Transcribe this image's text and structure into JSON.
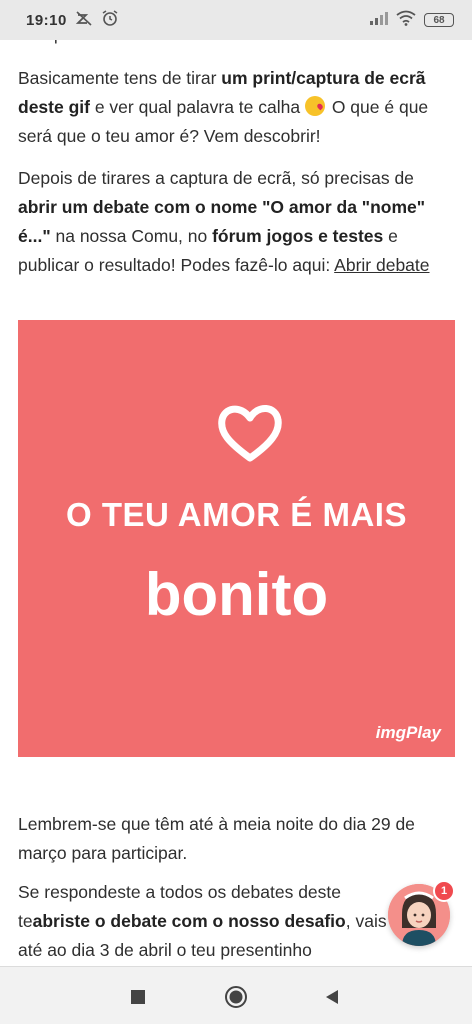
{
  "status_bar": {
    "time": "19:10",
    "battery": "68"
  },
  "article": {
    "partial_heading": "Em que consiste?",
    "p1": {
      "t1": "Basicamente tens de tirar ",
      "b1": "um print/captura de ecrã deste gif",
      "t2": " e ver qual palavra te calha ",
      "t3": " O que é que será que o teu amor é? Vem descobrir!"
    },
    "p2": {
      "t1": "Depois de tirares a captura de ecrã, só precisas de ",
      "b1": "abrir um debate com o nome \"O amor da \"nome\" é...\"",
      "t2": " na nossa Comu, no ",
      "b2": "fórum jogos e testes",
      "t3": " e publicar o resultado! Podes fazê-lo aqui: ",
      "link": "Abrir debate"
    },
    "p3": "Lembrem-se que têm até à meia noite do dia 29 de março para participar.",
    "p4": {
      "t1": "Se respondeste a todos os debates deste te",
      "b1": "abriste o debate com o nosso desafio",
      "t2": ", vais ",
      "t3": "até ao dia 3 de abril o teu presentinho"
    }
  },
  "gif": {
    "line1": "O TEU AMOR É MAIS",
    "line2": "bonito",
    "watermark": "imgPlay",
    "background_color": "#f16d6e"
  },
  "fab": {
    "badge": "1"
  },
  "icons": [
    "dnd-off-icon",
    "alarm-icon",
    "signal-icon",
    "wifi-icon",
    "battery-icon",
    "heart-icon",
    "stop-square-icon",
    "home-circle-icon",
    "back-triangle-icon"
  ]
}
